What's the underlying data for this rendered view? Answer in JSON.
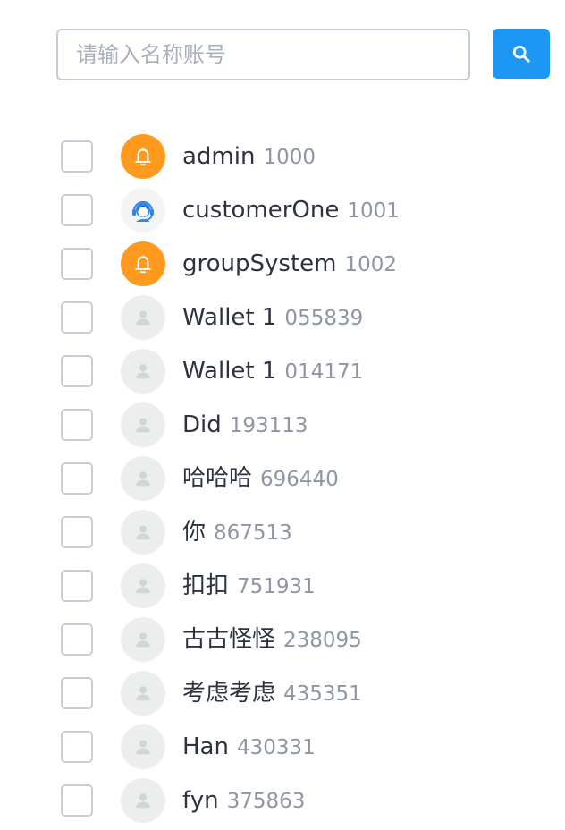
{
  "search": {
    "placeholder": "请输入名称账号",
    "value": "",
    "button_icon": "search-icon",
    "accent_color": "#1c97f3"
  },
  "users": [
    {
      "name": "admin",
      "id": "1000",
      "avatar": "bell-icon"
    },
    {
      "name": "customerOne",
      "id": "1001",
      "avatar": "headset-agent-icon"
    },
    {
      "name": "groupSystem",
      "id": "1002",
      "avatar": "bell-icon"
    },
    {
      "name": "Wallet 1",
      "id": "055839",
      "avatar": "default-user-icon"
    },
    {
      "name": "Wallet 1",
      "id": "014171",
      "avatar": "default-user-icon"
    },
    {
      "name": "Did",
      "id": "193113",
      "avatar": "default-user-icon"
    },
    {
      "name": "哈哈哈",
      "id": "696440",
      "avatar": "default-user-icon"
    },
    {
      "name": "你",
      "id": "867513",
      "avatar": "default-user-icon"
    },
    {
      "name": "扣扣",
      "id": "751931",
      "avatar": "default-user-icon"
    },
    {
      "name": "古古怪怪",
      "id": "238095",
      "avatar": "default-user-icon"
    },
    {
      "name": "考虑考虑",
      "id": "435351",
      "avatar": "default-user-icon"
    },
    {
      "name": "Han",
      "id": "430331",
      "avatar": "default-user-icon"
    },
    {
      "name": "fyn",
      "id": "375863",
      "avatar": "default-user-icon"
    }
  ],
  "colors": {
    "system_avatar": "#ff9a1f",
    "name_text": "#2d3240",
    "id_text": "#8f96a3"
  }
}
